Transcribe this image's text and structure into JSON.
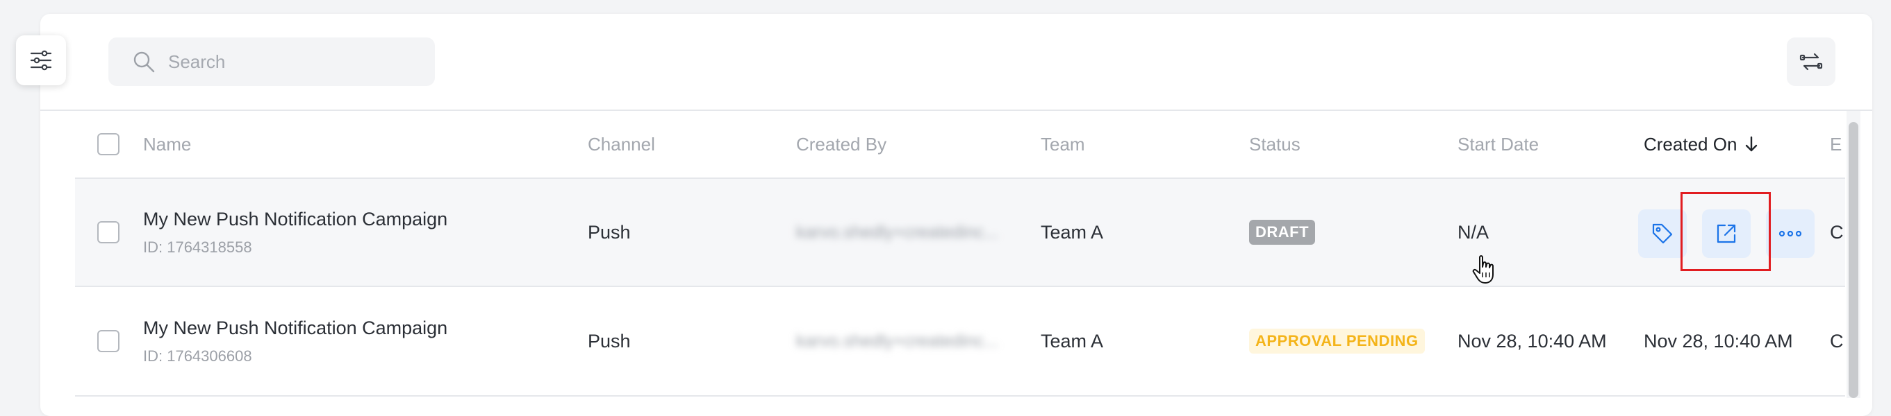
{
  "toolbar": {
    "search_placeholder": "Search",
    "filter_icon": "sliders-icon",
    "swap_icon": "swap-arrows-icon"
  },
  "table": {
    "columns": [
      "Name",
      "Channel",
      "Created By",
      "Team",
      "Status",
      "Start Date",
      "Created On",
      "E"
    ],
    "sort_column": "Created On",
    "sort_direction": "descending",
    "rows": [
      {
        "name": "My New Push Notification Campaign",
        "id": "ID: 1764318558",
        "channel": "Push",
        "created_by": "karvo.shedly+createdinc...",
        "team": "Team A",
        "status": "DRAFT",
        "start_date": "N/A",
        "overflow": "C"
      },
      {
        "name": "My New Push Notification Campaign",
        "id": "ID: 1764306608",
        "channel": "Push",
        "created_by": "karvo.shedly+createdinc...",
        "team": "Team A",
        "status": "APPROVAL PENDING",
        "start_date": "Nov 28, 10:40 AM",
        "created_on": "Nov 28, 10:40 AM",
        "overflow": "C"
      }
    ]
  },
  "colors": {
    "accent": "#1a73e8",
    "action_bg": "#e4eefc",
    "highlight": "#e11d21",
    "draft_badge": "#a4a7ab",
    "pending_text": "#f4b41a"
  }
}
